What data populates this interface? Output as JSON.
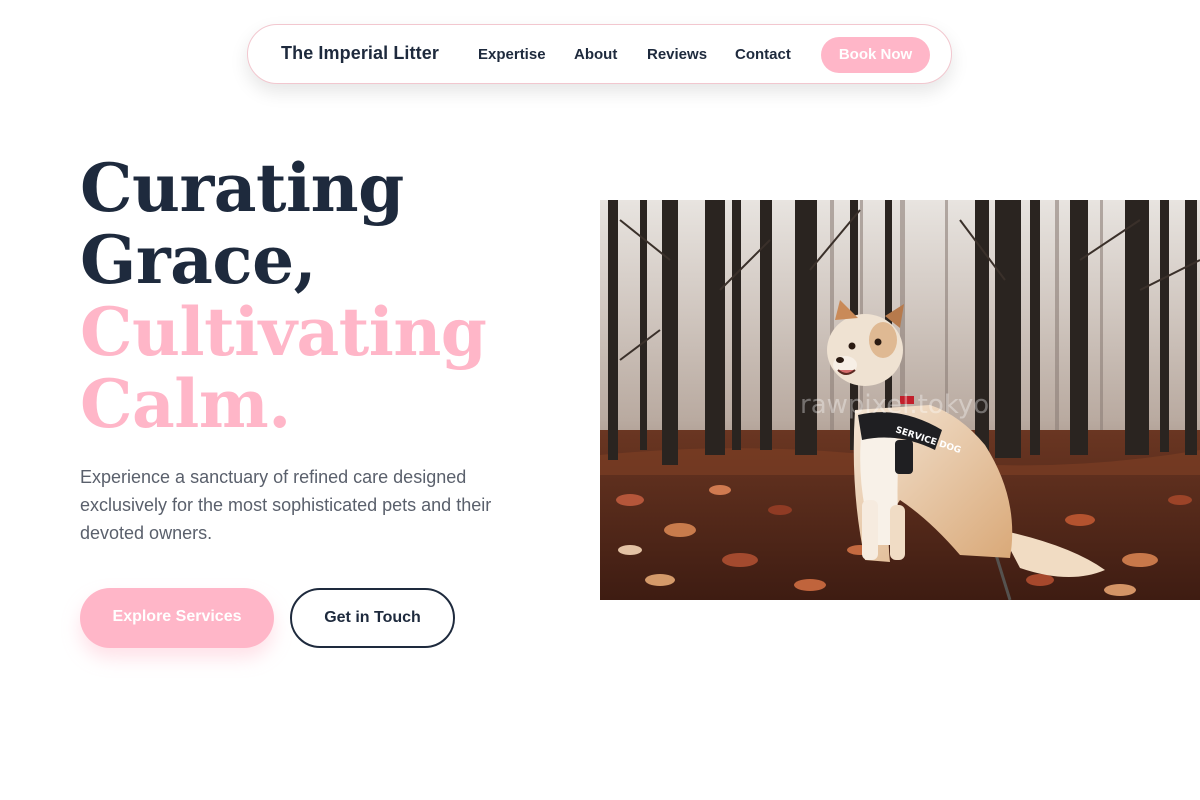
{
  "nav": {
    "brand": "The Imperial Litter",
    "links": [
      "Expertise",
      "About",
      "Reviews",
      "Contact"
    ],
    "cta": "Book Now"
  },
  "hero": {
    "headline_line1": "Curating",
    "headline_line2": "Grace,",
    "headline_line3": "Cultivating",
    "headline_line4": "Calm.",
    "subtitle": "Experience a sanctuary of refined care designed exclusively for the most sophisticated pets and their devoted owners.",
    "primary_button": "Explore Services",
    "secondary_button": "Get in Touch",
    "image": {
      "description_icon": "dog-photo",
      "harness_text": "SERVICE DOG",
      "watermark": "rawpixel.tokyo"
    }
  },
  "colors": {
    "navy": "#1e2a3d",
    "pink": "#ffb6c8",
    "body_text": "#5a606c",
    "nav_border": "#f2c7cf"
  }
}
